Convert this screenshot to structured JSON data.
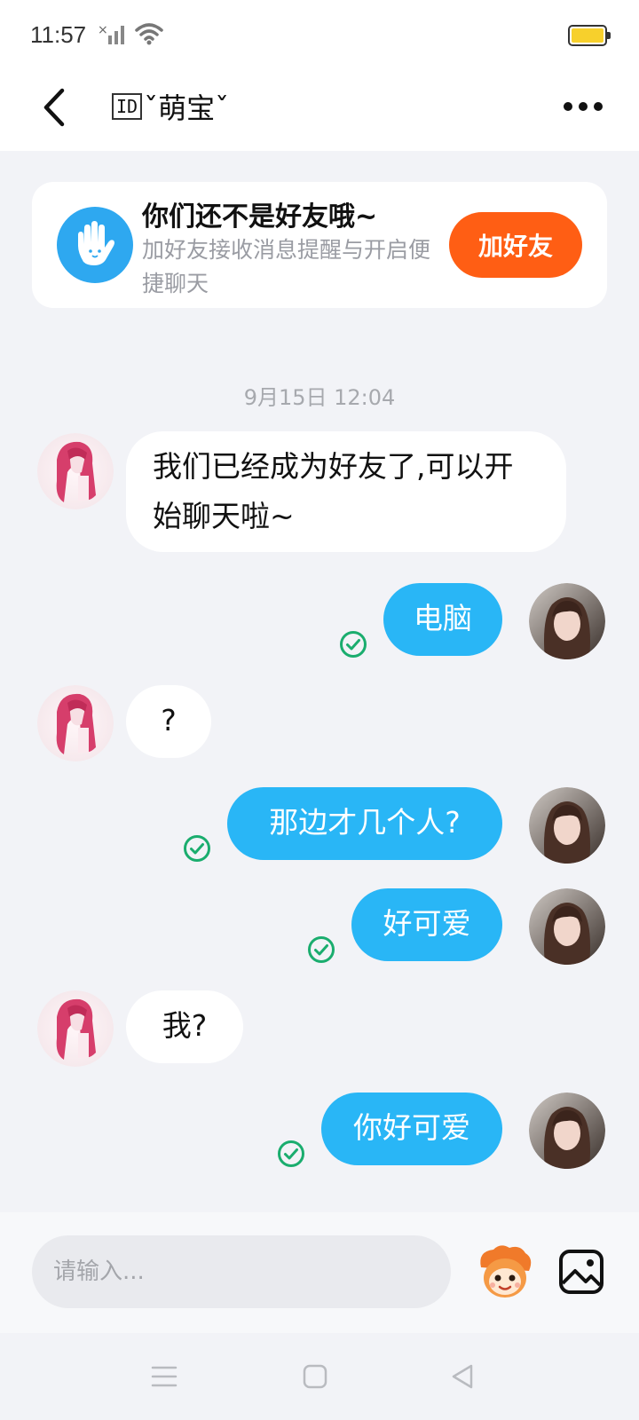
{
  "status": {
    "time": "11:57"
  },
  "header": {
    "id_badge": "ID",
    "title": "ˇ萌宝ˇ"
  },
  "friend_card": {
    "title": "你们还不是好友哦~",
    "description": "加好友接收消息提醒与开启便捷聊天",
    "button_label": "加好友"
  },
  "timestamp": "9月15日 12:04",
  "messages": [
    {
      "side": "in",
      "text": "我们已经成为好友了,可以开始聊天啦~"
    },
    {
      "side": "out",
      "text": "电脑"
    },
    {
      "side": "in",
      "text": "?"
    },
    {
      "side": "out",
      "text": "那边才几个人?"
    },
    {
      "side": "out",
      "text": "好可爱"
    },
    {
      "side": "in",
      "text": "我?"
    },
    {
      "side": "out",
      "text": "你好可爱"
    }
  ],
  "input": {
    "placeholder": "请输入..."
  },
  "colors": {
    "accent": "#29b6f6",
    "add_button": "#ff5e14",
    "read_check": "#1aad6e"
  }
}
